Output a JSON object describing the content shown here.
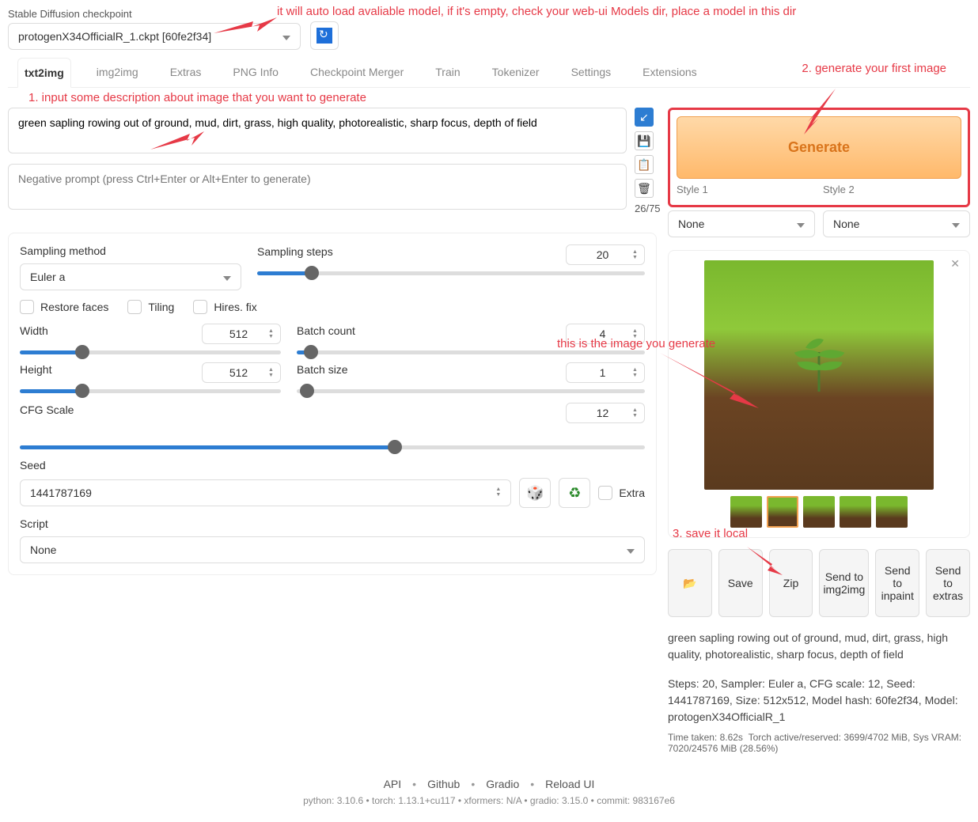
{
  "checkpoint": {
    "label": "Stable Diffusion checkpoint",
    "value": "protogenX34OfficialR_1.ckpt [60fe2f34]"
  },
  "annotations": {
    "top": "it will auto load avaliable model, if it's empty, check your web-ui Models dir, place a model in this dir",
    "step1": "1. input some description about image that you want to generate",
    "step2": "2. generate your first image",
    "img_note": "this is the image you generate",
    "step3": "3. save it local"
  },
  "tabs": [
    "txt2img",
    "img2img",
    "Extras",
    "PNG Info",
    "Checkpoint Merger",
    "Train",
    "Tokenizer",
    "Settings",
    "Extensions"
  ],
  "prompt": {
    "value": "green sapling rowing out of ground, mud, dirt, grass, high quality, photorealistic, sharp focus, depth of field",
    "neg_placeholder": "Negative prompt (press Ctrl+Enter or Alt+Enter to generate)",
    "token_count": "26/75"
  },
  "generate": {
    "label": "Generate"
  },
  "styles": {
    "label1": "Style 1",
    "label2": "Style 2",
    "value1": "None",
    "value2": "None"
  },
  "settings": {
    "sampling_method_label": "Sampling method",
    "sampling_method_value": "Euler a",
    "sampling_steps_label": "Sampling steps",
    "sampling_steps_value": "20",
    "restore_faces": "Restore faces",
    "tiling": "Tiling",
    "hires_fix": "Hires. fix",
    "width_label": "Width",
    "width_value": "512",
    "height_label": "Height",
    "height_value": "512",
    "batch_count_label": "Batch count",
    "batch_count_value": "4",
    "batch_size_label": "Batch size",
    "batch_size_value": "1",
    "cfg_label": "CFG Scale",
    "cfg_value": "12",
    "seed_label": "Seed",
    "seed_value": "1441787169",
    "extra_label": "Extra",
    "script_label": "Script",
    "script_value": "None"
  },
  "actions": {
    "folder": "📂",
    "save": "Save",
    "zip": "Zip",
    "send_img2img": "Send to img2img",
    "send_inpaint": "Send to inpaint",
    "send_extras": "Send to extras"
  },
  "output": {
    "prompt_echo": "green sapling rowing out of ground, mud, dirt, grass, high quality, photorealistic, sharp focus, depth of field",
    "params": "Steps: 20, Sampler: Euler a, CFG scale: 12, Seed: 1441787169, Size: 512x512, Model hash: 60fe2f34, Model: protogenX34OfficialR_1",
    "time": "Time taken: 8.62s",
    "mem": "Torch active/reserved: 3699/4702 MiB, Sys VRAM: 7020/24576 MiB (28.56%)"
  },
  "footer": {
    "links": [
      "API",
      "Github",
      "Gradio",
      "Reload UI"
    ],
    "meta": "python: 3.10.6   •   torch: 1.13.1+cu117   •   xformers: N/A   •   gradio: 3.15.0   •   commit: 983167e6"
  }
}
